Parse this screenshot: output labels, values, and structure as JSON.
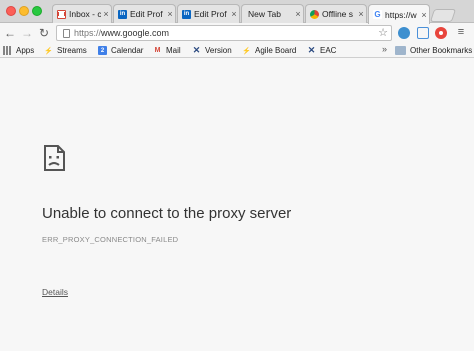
{
  "browser": {
    "tabs": [
      {
        "favicon": "gmail-icon",
        "title": "Inbox - c"
      },
      {
        "favicon": "linkedin-icon",
        "title": "Edit Prof"
      },
      {
        "favicon": "linkedin-icon",
        "title": "Edit Prof"
      },
      {
        "favicon": "",
        "title": "New Tab"
      },
      {
        "favicon": "offline-icon",
        "title": "Offline s"
      },
      {
        "favicon": "google-icon",
        "title": "https://w",
        "active": true
      }
    ],
    "tab_close_glyph": "×",
    "omnibox": {
      "scheme": "https://",
      "host": "www.google.com"
    },
    "toolbar_glyphs": {
      "back": "←",
      "forward": "→",
      "reload": "↻",
      "star": "☆",
      "menu": "≡",
      "ext1": "❶"
    }
  },
  "bookmarks": [
    {
      "icon": "apps-icon",
      "label": "Apps"
    },
    {
      "icon": "streams-icon",
      "label": "Streams"
    },
    {
      "icon": "calendar-icon",
      "label": "Calendar",
      "badge": "2"
    },
    {
      "icon": "gmail-icon",
      "label": "Mail",
      "badge": "M"
    },
    {
      "icon": "version-icon",
      "label": "Version"
    },
    {
      "icon": "agile-board-icon",
      "label": "Agile Board"
    },
    {
      "icon": "eac-icon",
      "label": "EAC"
    }
  ],
  "bookmarks_overflow": "»",
  "other_bookmarks": "Other Bookmarks",
  "error": {
    "title": "Unable to connect to the proxy server",
    "code": "ERR_PROXY_CONNECTION_FAILED",
    "details_link": "Details"
  },
  "colors": {
    "tab_strip": "#d6d6d6",
    "page_bg": "#f7f7f7",
    "title_text": "#333333",
    "code_text": "#8a8a8a"
  }
}
